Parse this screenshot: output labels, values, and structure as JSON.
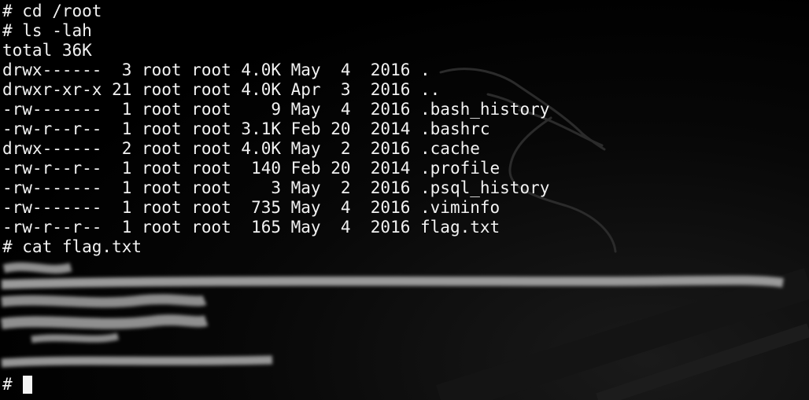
{
  "terminal": {
    "lines": [
      "# cd /root",
      "# ls -lah",
      "total 36K",
      "drwx------  3 root root 4.0K May  4  2016 .",
      "drwxr-xr-x 21 root root 4.0K Apr  3  2016 ..",
      "-rw-------  1 root root    9 May  4  2016 .bash_history",
      "-rw-r--r--  1 root root 3.1K Feb 20  2014 .bashrc",
      "drwx------  2 root root 4.0K May  2  2016 .cache",
      "-rw-r--r--  1 root root  140 Feb 20  2014 .profile",
      "-rw-------  1 root root    3 May  2  2016 .psql_history",
      "-rw-------  1 root root  735 May  4  2016 .viminfo",
      "-rw-r--r--  1 root root  165 May  4  2016 flag.txt",
      "# cat flag.txt"
    ],
    "prompt": "#"
  },
  "colors": {
    "background": "#000000",
    "text": "#f2f2f2",
    "cursor": "#f5f5f5",
    "redaction": "#9a9a9a"
  },
  "icons": {
    "background_logo": "kali-dragon-icon"
  }
}
